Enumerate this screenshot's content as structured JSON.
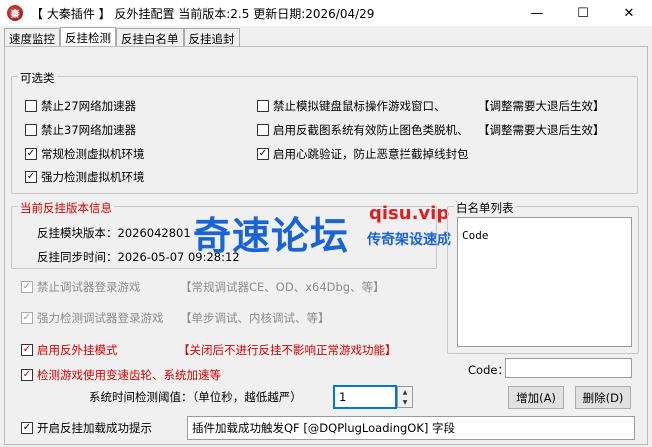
{
  "window": {
    "title": "【 大秦插件 】 反外挂配置 当前版本:2.5 更新日期:2026/04/29",
    "app_icon_glyph": "秦",
    "minimize": "—",
    "maximize": "☐",
    "close": "✕"
  },
  "tabs": [
    "速度监控",
    "反挂检测",
    "反挂白名单",
    "反挂追封"
  ],
  "active_tab": "反挂检测",
  "options_group": {
    "title": "可选类",
    "items": [
      {
        "label": "禁止27网络加速器",
        "checked": false
      },
      {
        "label": "禁止37网络加速器",
        "checked": false
      },
      {
        "label": "常规检测虚拟机环境",
        "checked": true
      },
      {
        "label": "强力检测虚拟机环境",
        "checked": true
      },
      {
        "label": "禁止模拟键盘鼠标操作游戏窗口、",
        "checked": false
      },
      {
        "label": "启用反截图系统有效防止图色类脱机、",
        "checked": false
      },
      {
        "label": "启用心跳验证，防止恶意拦截掉线封包",
        "checked": true
      }
    ],
    "note1": "【调整需要大退后生效】",
    "note2": "【调整需要大退后生效】"
  },
  "version_group": {
    "title": "当前反挂版本信息",
    "module_version": "反挂模块版本：2026042801",
    "sync_time": "反挂同步时间：2026-05-07  09:28:12"
  },
  "disabled_options": [
    {
      "label": "禁止调试器登录游戏",
      "note": "【常规调试器CE、OD、x64Dbg、等】",
      "checked": true
    },
    {
      "label": "强力检测调试器登录游戏",
      "note": "【单步调试、内核调试、等】",
      "checked": true
    }
  ],
  "anti_cheat_mode": {
    "label": "启用反外挂模式",
    "note": "【关闭后不进行反挂不影响正常游戏功能】",
    "checked": true
  },
  "speed_gear": {
    "label": "检测游戏使用变速齿轮、系统加速等",
    "checked": true
  },
  "threshold": {
    "label": "系统时间检测阈值：（单位秒，越低越严）",
    "value": "1"
  },
  "load_success": {
    "label": "开启反挂加载成功提示",
    "checked": true,
    "message": "插件加载成功触发QF [@DQPlugLoadingOK] 字段"
  },
  "whitelist": {
    "title": "白名单列表",
    "items": [
      "Code"
    ],
    "code_label": "Code：",
    "code_value": "",
    "add_button": "增加(A)",
    "delete_button": "删除(D)"
  },
  "watermark": {
    "big": "奇速论坛",
    "url": "qisu.vip",
    "sub": "传奇架设速成"
  },
  "colors": {
    "accent_red": "#d40000",
    "watermark_blue": "#1a63d6"
  }
}
